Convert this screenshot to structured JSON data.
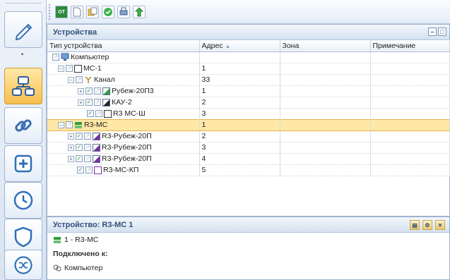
{
  "toolbar": {
    "buttons": [
      {
        "icon": "ot-icon",
        "label": "OT"
      },
      {
        "icon": "new-doc-icon",
        "label": ""
      },
      {
        "icon": "copy-icon",
        "label": ""
      },
      {
        "icon": "check-icon",
        "label": ""
      },
      {
        "icon": "print-icon",
        "label": ""
      },
      {
        "icon": "upload-icon",
        "label": ""
      }
    ]
  },
  "sidebar": {
    "items": [
      {
        "icon": "pencil-icon"
      },
      {
        "icon": "devices-icon"
      },
      {
        "icon": "link-icon"
      },
      {
        "icon": "add-icon"
      },
      {
        "icon": "clock-icon"
      },
      {
        "icon": "shield-icon"
      },
      {
        "icon": "shuffle-icon"
      }
    ],
    "active_index": 1
  },
  "devices_panel": {
    "title": "Устройства",
    "columns": [
      "Тип устройства",
      "Адрес",
      "Зона",
      "Примечание"
    ],
    "sort_indicator": "▲",
    "rows": [
      {
        "name": "Компьютер",
        "address": "",
        "zone": "",
        "note": "",
        "level": 0
      },
      {
        "name": "МС-1",
        "address": "1",
        "zone": "",
        "note": "",
        "level": 1
      },
      {
        "name": "Канал",
        "address": "33",
        "zone": "",
        "note": "",
        "level": 2
      },
      {
        "name": "Рубеж-20П3",
        "address": "1",
        "zone": "",
        "note": "",
        "level": 3
      },
      {
        "name": "КАУ-2",
        "address": "2",
        "zone": "",
        "note": "",
        "level": 3
      },
      {
        "name": "R3 МС-Ш",
        "address": "3",
        "zone": "",
        "note": "",
        "level": 3
      },
      {
        "name": "R3-МС",
        "address": "1",
        "zone": "",
        "note": "",
        "level": 1,
        "selected": true
      },
      {
        "name": "R3-Рубеж-20П",
        "address": "2",
        "zone": "",
        "note": "",
        "level": 2
      },
      {
        "name": "R3-Рубеж-20П",
        "address": "3",
        "zone": "",
        "note": "",
        "level": 2
      },
      {
        "name": "R3-Рубеж-20П",
        "address": "4",
        "zone": "",
        "note": "",
        "level": 2
      },
      {
        "name": "R3-МС-КП",
        "address": "5",
        "zone": "",
        "note": "",
        "level": 2
      }
    ]
  },
  "details_panel": {
    "title": "Устройство: R3-МС 1",
    "device_line": "1 - R3-МС",
    "connected_label": "Подключено к:",
    "connected_to": "Компьютер"
  },
  "colors": {
    "selection": "#ffe7a6",
    "accent": "#f6bd4d",
    "panel_title": "#2f4f7d"
  }
}
